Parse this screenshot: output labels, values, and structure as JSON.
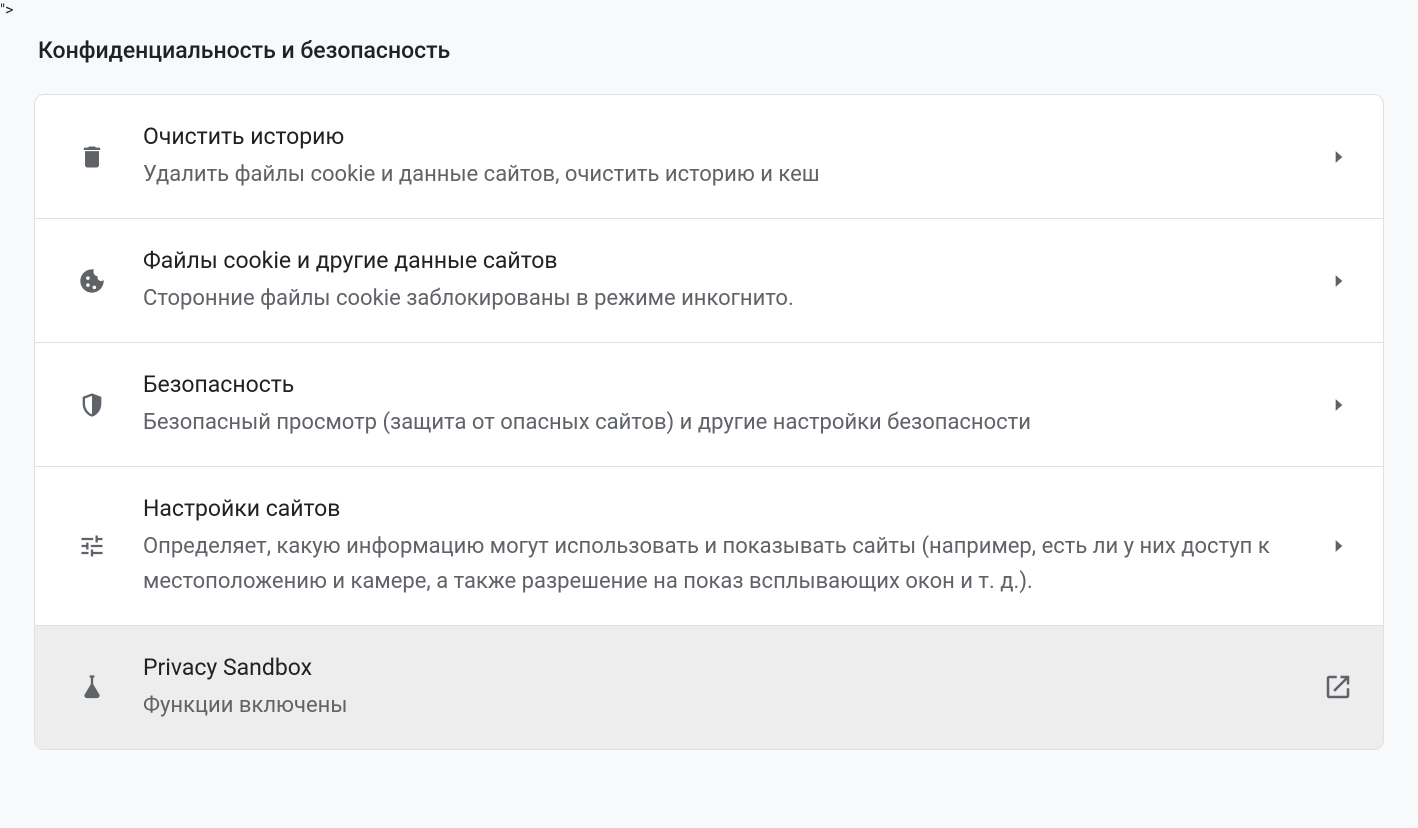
{
  "section": {
    "title": "Конфиденциальность и безопасность"
  },
  "rows": [
    {
      "title": "Очистить историю",
      "desc": "Удалить файлы cookie и данные сайтов, очистить историю и кеш"
    },
    {
      "title": "Файлы cookie и другие данные сайтов",
      "desc": "Сторонние файлы cookie заблокированы в режиме инкогнито."
    },
    {
      "title": "Безопасность",
      "desc": "Безопасный просмотр (защита от опасных сайтов) и другие настройки безопасности"
    },
    {
      "title": "Настройки сайтов",
      "desc": "Определяет, какую информацию могут использовать и показывать сайты (например, есть ли у них доступ к местоположению и камере, а также разрешение на показ всплывающих окон и т. д.)."
    },
    {
      "title": "Privacy Sandbox",
      "desc": "Функции включены"
    }
  ]
}
